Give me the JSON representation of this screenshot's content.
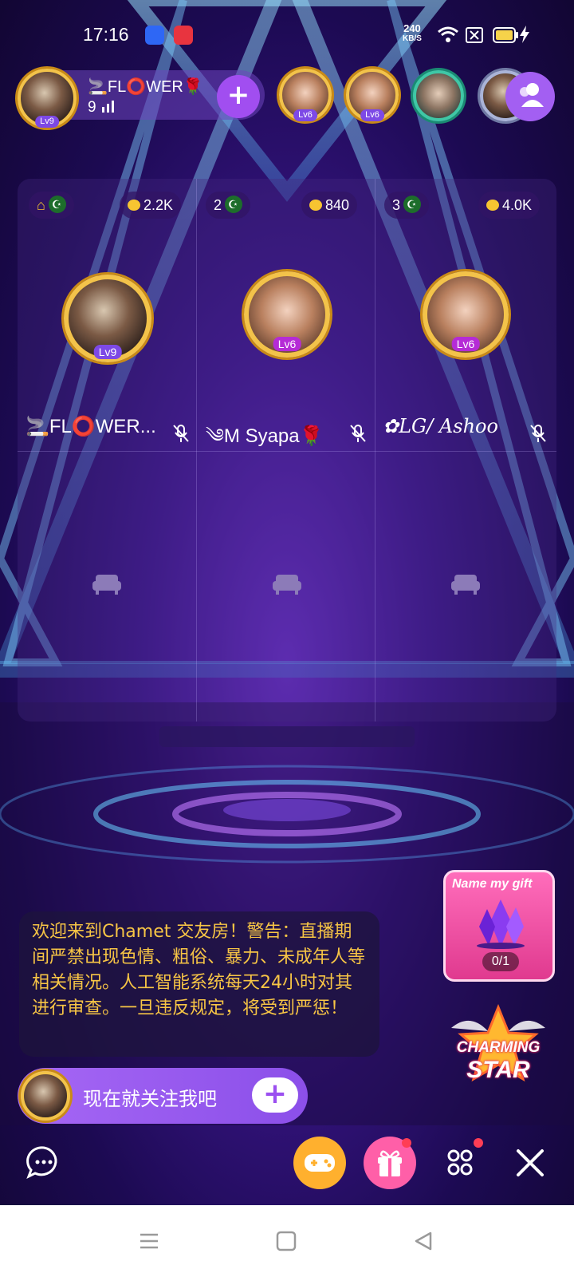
{
  "status_bar": {
    "time": "17:16",
    "net_speed_value": "240",
    "net_speed_unit": "KB/S",
    "icons": [
      "baidu-app-icon",
      "screen-record-icon",
      "wifi-icon",
      "sim-off-icon",
      "battery-icon",
      "charging-icon"
    ]
  },
  "host": {
    "name": "🚬FL⭕WER🌹",
    "count": "9",
    "level": "Lv9"
  },
  "viewers": [
    {
      "level": "Lv6"
    },
    {
      "level": "Lv6"
    },
    {
      "level": ""
    }
  ],
  "seats": [
    {
      "number": "",
      "coins": "2.2K",
      "level": "Lv9",
      "name": "🚬FL⭕WER...",
      "has_home_icon": true
    },
    {
      "number": "2",
      "coins": "840",
      "level": "Lv6",
      "name": "༄M Syapa🌹"
    },
    {
      "number": "3",
      "coins": "4.0K",
      "level": "Lv6",
      "name": "✿LG/ Ashoo"
    }
  ],
  "welcome_message": "欢迎来到Chamet 交友房！警告：直播期间严禁出现色情、粗俗、暴力、未成年人等相关情况。人工智能系统每天24小时对其进行审查。一旦违反规定，将受到严惩！",
  "gift_card": {
    "title": "Name my gift",
    "count": "0/1"
  },
  "charming_star": {
    "line1": "CHARMING",
    "line2": "STAR"
  },
  "follow_bar": {
    "text": "现在就关注我吧"
  },
  "toolbar": {
    "buttons": [
      "chat-icon",
      "game-icon",
      "gift-icon",
      "more-apps-icon",
      "close-icon"
    ]
  },
  "colors": {
    "accent_purple": "#a14ef0",
    "welcome_text": "#f7c545",
    "gift_pink": "#e03a8f",
    "game_orange": "#ffb02e"
  }
}
